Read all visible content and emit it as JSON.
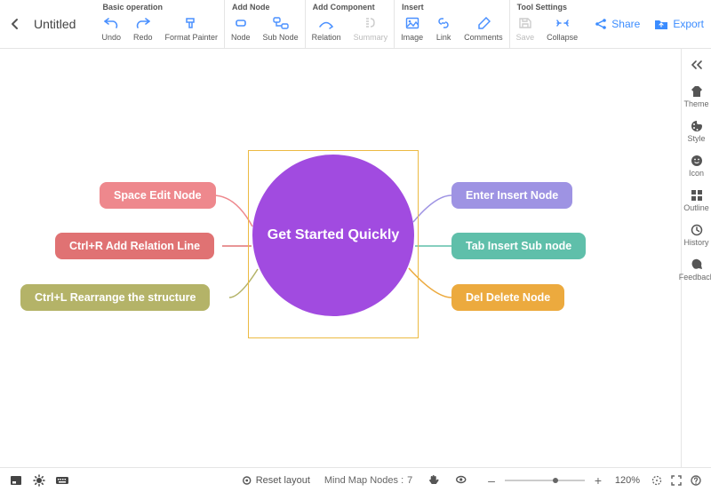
{
  "header": {
    "title": "Untitled",
    "share": "Share",
    "export": "Export"
  },
  "toolbar": {
    "groups": [
      {
        "title": "Basic operation",
        "buttons": [
          {
            "id": "undo",
            "label": "Undo",
            "disabled": false
          },
          {
            "id": "redo",
            "label": "Redo",
            "disabled": false
          },
          {
            "id": "format-painter",
            "label": "Format Painter",
            "disabled": false
          }
        ]
      },
      {
        "title": "Add Node",
        "buttons": [
          {
            "id": "node",
            "label": "Node",
            "disabled": false
          },
          {
            "id": "sub-node",
            "label": "Sub Node",
            "disabled": false
          }
        ]
      },
      {
        "title": "Add Component",
        "buttons": [
          {
            "id": "relation",
            "label": "Relation",
            "disabled": false
          },
          {
            "id": "summary",
            "label": "Summary",
            "disabled": true
          }
        ]
      },
      {
        "title": "Insert",
        "buttons": [
          {
            "id": "image",
            "label": "Image",
            "disabled": false
          },
          {
            "id": "link",
            "label": "Link",
            "disabled": false
          },
          {
            "id": "comments",
            "label": "Comments",
            "disabled": false
          }
        ]
      },
      {
        "title": "Tool Settings",
        "buttons": [
          {
            "id": "save",
            "label": "Save",
            "disabled": true
          },
          {
            "id": "collapse",
            "label": "Collapse",
            "disabled": false
          }
        ]
      }
    ]
  },
  "sidebar": [
    {
      "id": "theme",
      "label": "Theme"
    },
    {
      "id": "style",
      "label": "Style"
    },
    {
      "id": "icon",
      "label": "Icon"
    },
    {
      "id": "outline",
      "label": "Outline"
    },
    {
      "id": "history",
      "label": "History"
    },
    {
      "id": "feedback",
      "label": "Feedback"
    }
  ],
  "mindmap": {
    "center": "Get Started Quickly",
    "left_nodes": [
      {
        "text": "Space Edit Node",
        "color": "#ee888d"
      },
      {
        "text": "Ctrl+R Add Relation Line",
        "color": "#e07273"
      },
      {
        "text": "Ctrl+L Rearrange the structure",
        "color": "#b4b368"
      }
    ],
    "right_nodes": [
      {
        "text": "Enter Insert Node",
        "color": "#9e93e3"
      },
      {
        "text": "Tab Insert Sub node",
        "color": "#5fbfaa"
      },
      {
        "text": "Del Delete Node",
        "color": "#ecaa3e"
      }
    ]
  },
  "status": {
    "reset_layout": "Reset layout",
    "nodes_label": "Mind Map Nodes :",
    "nodes_count": 7,
    "zoom_percent": "120%",
    "zoom_value": 0.6
  }
}
